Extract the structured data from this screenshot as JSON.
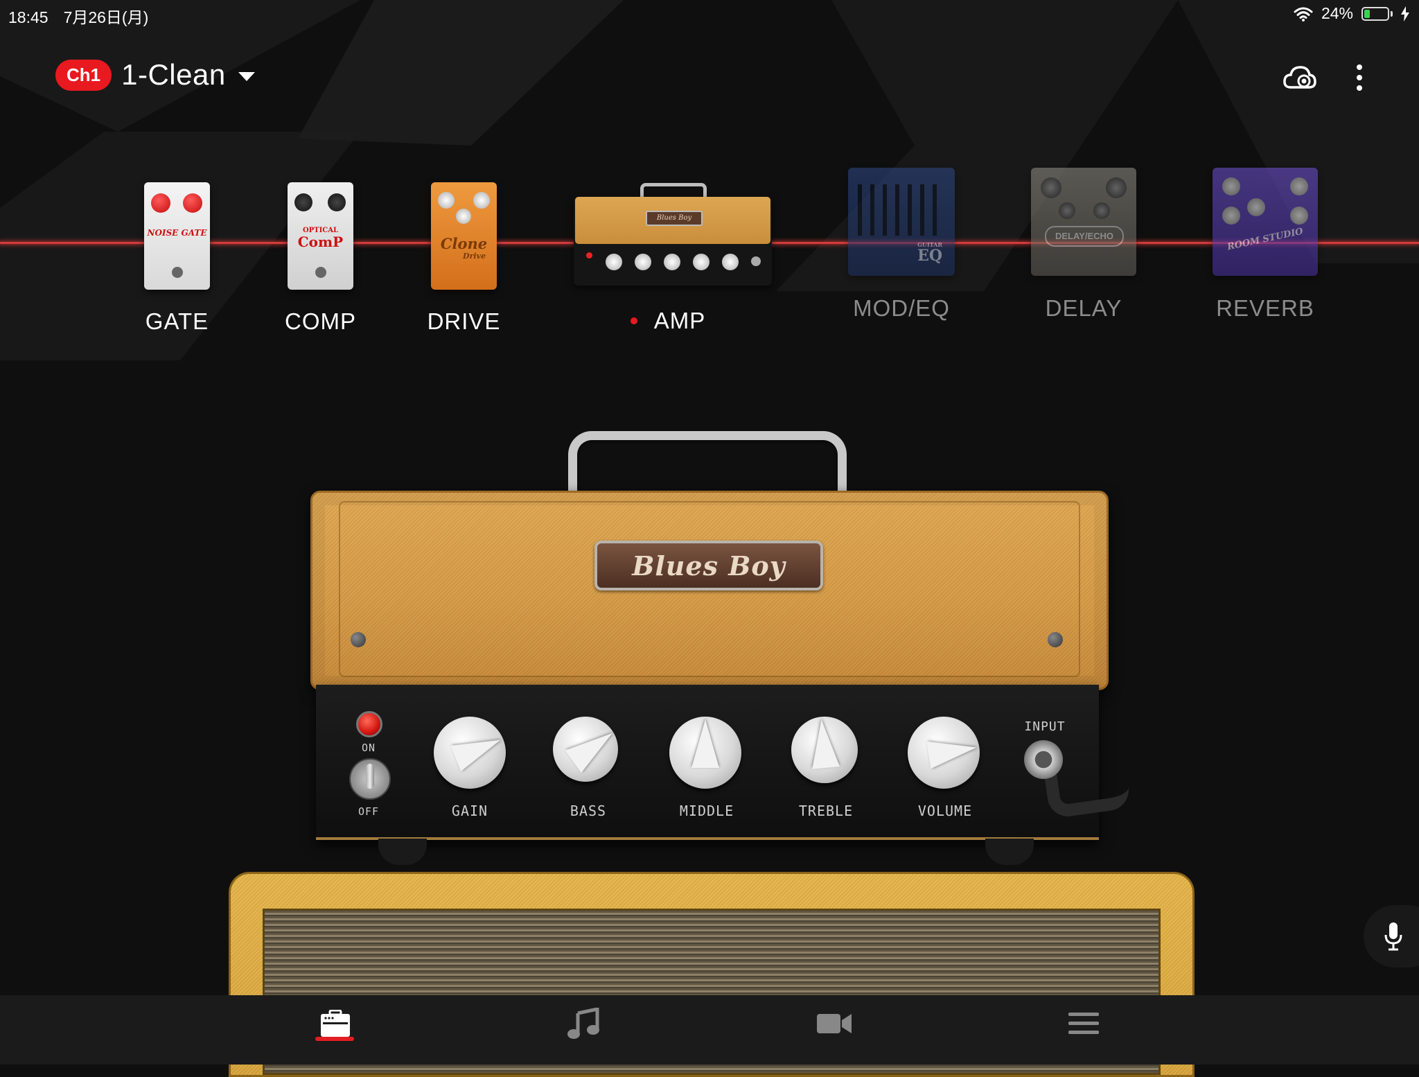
{
  "status_bar": {
    "time": "18:45",
    "date": "7月26日(月)",
    "battery_percent": "24%",
    "battery_level": 0.24,
    "charging": true,
    "wifi": "wifi-icon"
  },
  "header": {
    "channel_badge": "Ch1",
    "preset_name": "1-Clean",
    "cloud_icon": "cloud-sync-icon",
    "menu_icon": "more-vertical-icon"
  },
  "chain": {
    "gate": {
      "label": "GATE",
      "pedal_text": "NOISE GATE",
      "active": true
    },
    "comp": {
      "label": "COMP",
      "pedal_text": "ComP",
      "pedal_subtext": "OPTICAL",
      "active": true
    },
    "drive": {
      "label": "DRIVE",
      "pedal_text": "Clone",
      "pedal_subtext": "Drive",
      "active": true
    },
    "amp": {
      "label": "AMP",
      "plate_text": "Blues Boy",
      "selected": true
    },
    "modeq": {
      "label": "MOD/EQ",
      "pedal_text": "EQ",
      "pedal_subtext": "GUITAR",
      "active": false
    },
    "delay": {
      "label": "DELAY",
      "pedal_text": "DELAY/ECHO",
      "active": false
    },
    "reverb": {
      "label": "REVERB",
      "pedal_text": "ROOM STUDIO",
      "active": false
    }
  },
  "amp": {
    "name": "Blues Boy",
    "power": {
      "on_label": "ON",
      "off_label": "OFF",
      "state": "on"
    },
    "input_label": "INPUT",
    "knobs": [
      {
        "id": "gain",
        "label": "GAIN",
        "value": 7.5
      },
      {
        "id": "bass",
        "label": "BASS",
        "value": 7.0
      },
      {
        "id": "middle",
        "label": "MIDDLE",
        "value": 5.0
      },
      {
        "id": "treble",
        "label": "TREBLE",
        "value": 4.8
      },
      {
        "id": "volume",
        "label": "VOLUME",
        "value": 8.0
      }
    ],
    "scale": [
      "0",
      "1",
      "2",
      "3",
      "4",
      "5",
      "6",
      "7",
      "8",
      "9",
      "10"
    ]
  },
  "tabs": [
    {
      "id": "amp",
      "icon": "amp-icon",
      "active": true
    },
    {
      "id": "music",
      "icon": "music-note-icon",
      "active": false
    },
    {
      "id": "video",
      "icon": "video-camera-icon",
      "active": false
    },
    {
      "id": "menu",
      "icon": "hamburger-menu-icon",
      "active": false
    }
  ],
  "mic_icon": "microphone-icon",
  "colors": {
    "accent": "#e8191f",
    "background": "#0f0f0f",
    "chain_line": "#d23b3b",
    "inactive_label": "#8c8c8c"
  }
}
